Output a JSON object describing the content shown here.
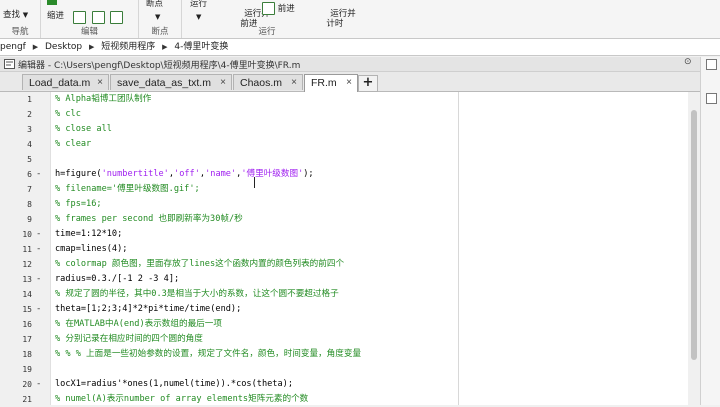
{
  "toolstrip": {
    "nav_label": "导航",
    "nav_find": "查找",
    "edit_indent": "缩进",
    "edit_label": "编辑",
    "breakpoint_label": "断点",
    "breakpoint_section_label": "断点",
    "run_label": "运行",
    "run_advance_label": "运行并\n前进",
    "advance_label": "前进",
    "run_time_label": "运行并\n计时",
    "run_section_label": "运行"
  },
  "address_bar": {
    "crumbs": [
      "pengf",
      "Desktop",
      "短视频用程序",
      "4-傅里叶变换"
    ]
  },
  "editor": {
    "title": "编辑器 - C:\\Users\\pengf\\Desktop\\短视频用程序\\4-傅里叶变换\\FR.m",
    "tabs": [
      {
        "label": "Load_data.m",
        "active": false
      },
      {
        "label": "save_data_as_txt.m",
        "active": false
      },
      {
        "label": "Chaos.m",
        "active": false
      },
      {
        "label": "FR.m",
        "active": true
      }
    ],
    "add_tab_label": "+",
    "lines": [
      {
        "n": "1",
        "dash": false,
        "parts": [
          {
            "t": "% Alpha韬博工团队制作",
            "c": "cmt"
          }
        ]
      },
      {
        "n": "2",
        "dash": false,
        "parts": [
          {
            "t": "% clc",
            "c": "cmt"
          }
        ]
      },
      {
        "n": "3",
        "dash": false,
        "parts": [
          {
            "t": "% close all",
            "c": "cmt"
          }
        ]
      },
      {
        "n": "4",
        "dash": false,
        "parts": [
          {
            "t": "% clear",
            "c": "cmt"
          }
        ]
      },
      {
        "n": "5",
        "dash": false,
        "parts": [
          {
            "t": "",
            "c": ""
          }
        ]
      },
      {
        "n": "6",
        "dash": true,
        "parts": [
          {
            "t": "h=figure(",
            "c": ""
          },
          {
            "t": "'numbertitle'",
            "c": "str"
          },
          {
            "t": ",",
            "c": ""
          },
          {
            "t": "'off'",
            "c": "str"
          },
          {
            "t": ",",
            "c": ""
          },
          {
            "t": "'name'",
            "c": "str"
          },
          {
            "t": ",",
            "c": ""
          },
          {
            "t": "'傅里叶级数图'",
            "c": "str"
          },
          {
            "t": ");",
            "c": ""
          }
        ]
      },
      {
        "n": "7",
        "dash": false,
        "parts": [
          {
            "t": "% filename='傅里叶级数图.gif';",
            "c": "cmt"
          }
        ]
      },
      {
        "n": "8",
        "dash": false,
        "parts": [
          {
            "t": "% fps=16;",
            "c": "cmt"
          }
        ]
      },
      {
        "n": "9",
        "dash": false,
        "parts": [
          {
            "t": "% frames per second 也即刷新率为30帧/秒",
            "c": "cmt"
          }
        ]
      },
      {
        "n": "10",
        "dash": true,
        "parts": [
          {
            "t": "time=1:12*10;",
            "c": ""
          }
        ]
      },
      {
        "n": "11",
        "dash": true,
        "parts": [
          {
            "t": "cmap=lines(4);",
            "c": ""
          }
        ]
      },
      {
        "n": "12",
        "dash": false,
        "parts": [
          {
            "t": "% colormap 颜色图，里面存放了lines这个函数内置的颜色列表的前四个",
            "c": "cmt"
          }
        ]
      },
      {
        "n": "13",
        "dash": true,
        "parts": [
          {
            "t": "radius=0.3./[-1 2 -3 4];",
            "c": ""
          }
        ]
      },
      {
        "n": "14",
        "dash": false,
        "parts": [
          {
            "t": "% 规定了圆的半径，其中0.3是相当于大小的系数，让这个圆不要超过格子",
            "c": "cmt"
          }
        ]
      },
      {
        "n": "15",
        "dash": true,
        "parts": [
          {
            "t": "theta=[1;2;3;4]*2*pi*time/time(end);",
            "c": ""
          }
        ]
      },
      {
        "n": "16",
        "dash": false,
        "parts": [
          {
            "t": "% 在MATLAB中A(end)表示数组的最后一项",
            "c": "cmt"
          }
        ]
      },
      {
        "n": "17",
        "dash": false,
        "parts": [
          {
            "t": "% 分别记录在相应时间的四个圆的角度",
            "c": "cmt"
          }
        ]
      },
      {
        "n": "18",
        "dash": false,
        "parts": [
          {
            "t": "% % % 上面是一些初始参数的设置，规定了文件名，颜色，时间变量，角度变量",
            "c": "cmt"
          }
        ]
      },
      {
        "n": "19",
        "dash": false,
        "parts": [
          {
            "t": "",
            "c": ""
          }
        ]
      },
      {
        "n": "20",
        "dash": true,
        "parts": [
          {
            "t": "locX1=radius'*ones(1,numel(time)).*cos(theta);",
            "c": ""
          }
        ]
      },
      {
        "n": "21",
        "dash": false,
        "parts": [
          {
            "t": "% numel(A)表示number of array elements矩阵元素的个数",
            "c": "cmt"
          }
        ]
      }
    ]
  }
}
